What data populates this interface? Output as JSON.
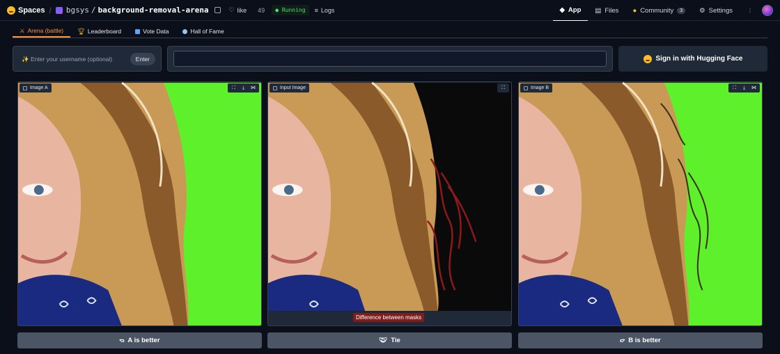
{
  "header": {
    "brand": "Spaces",
    "owner": "bgsys",
    "repo": "background-removal-arena",
    "like_label": "like",
    "like_count": "49",
    "status": "Running",
    "logs": "Logs",
    "nav": [
      {
        "label": "App",
        "icon": "app-icon"
      },
      {
        "label": "Files",
        "icon": "files-icon"
      },
      {
        "label": "Community",
        "icon": "community-icon",
        "badge": "3"
      },
      {
        "label": "Settings",
        "icon": "gear-icon"
      }
    ]
  },
  "tabs": [
    {
      "label": "Arena (battle)",
      "icon": "swords-icon",
      "active": true
    },
    {
      "label": "Leaderboard",
      "icon": "trophy-icon"
    },
    {
      "label": "Vote Data",
      "icon": "bar-chart-icon"
    },
    {
      "label": "Hall of Fame",
      "icon": "people-icon"
    }
  ],
  "username": {
    "placeholder": "✨ Enter your username (optional)",
    "enter_label": "Enter"
  },
  "signin": {
    "label": "Sign in with Hugging Face"
  },
  "panels": {
    "a": {
      "label": "Image A"
    },
    "input": {
      "label": "Input Image",
      "caption": "Difference between masks"
    },
    "b": {
      "label": "Image B"
    }
  },
  "votes": {
    "a": "A is better",
    "tie": "Tie",
    "b": "B is better"
  },
  "colors": {
    "accent": "#fb923c",
    "green_screen": "#5ef02a",
    "background": "#0b0f19"
  }
}
